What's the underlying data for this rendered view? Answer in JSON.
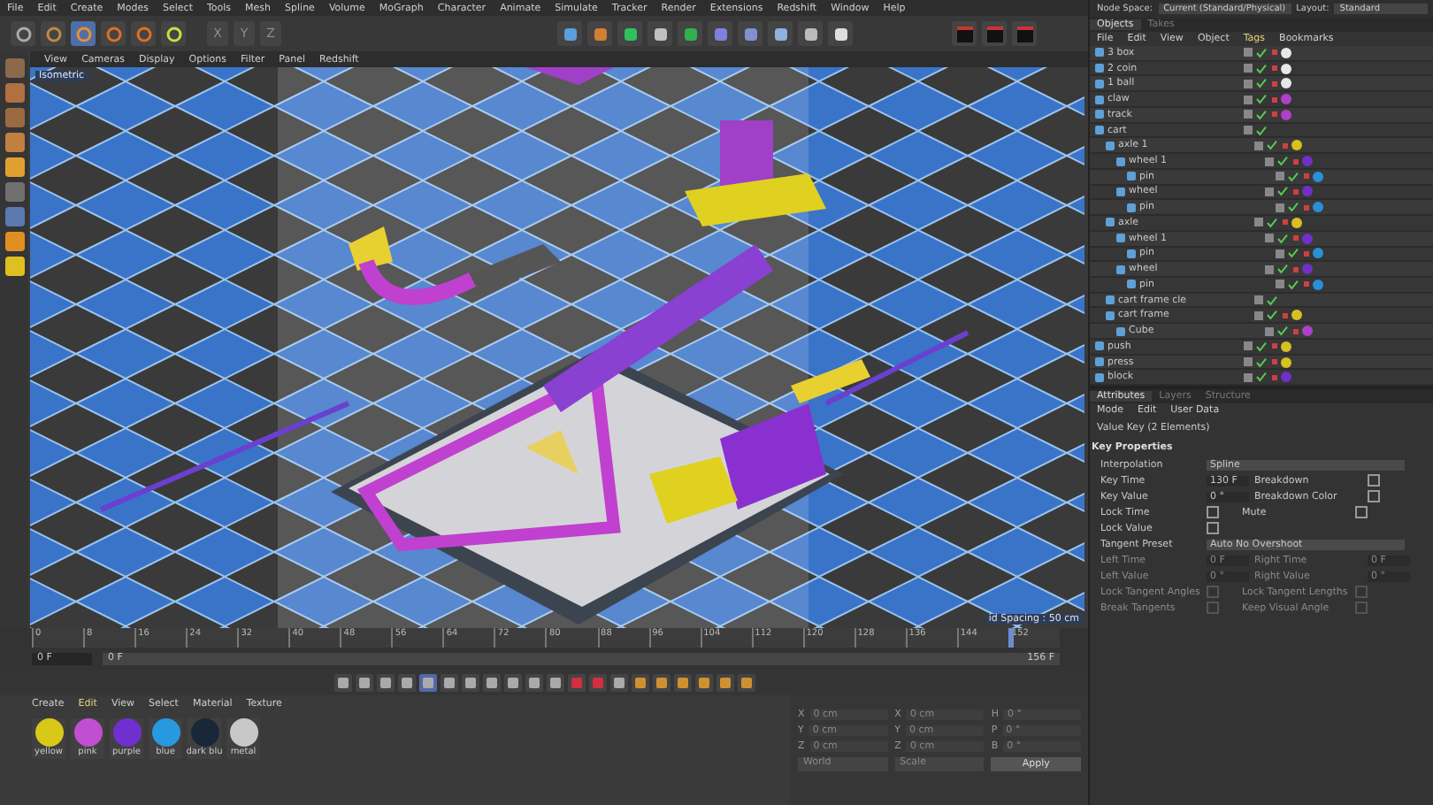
{
  "menu_bar": [
    "File",
    "Edit",
    "Create",
    "Modes",
    "Select",
    "Tools",
    "Mesh",
    "Spline",
    "Volume",
    "MoGraph",
    "Character",
    "Animate",
    "Simulate",
    "Tracker",
    "Render",
    "Extensions",
    "Redshift",
    "Window",
    "Help"
  ],
  "axis_locks": [
    "X",
    "Y",
    "Z"
  ],
  "node_space": {
    "label": "Node Space:",
    "value": "Current (Standard/Physical)",
    "layout_label": "Layout:",
    "layout_value": "Standard"
  },
  "viewport": {
    "menu": [
      "View",
      "Cameras",
      "Display",
      "Options",
      "Filter",
      "Panel",
      "Redshift"
    ],
    "camera": "Isometric",
    "grid_info": "id Spacing : 50 cm"
  },
  "objects": {
    "tabs": [
      {
        "label": "Objects",
        "selected": true
      },
      {
        "label": "Takes",
        "selected": false
      }
    ],
    "menu": [
      {
        "label": "File",
        "selected": false
      },
      {
        "label": "Edit",
        "selected": false
      },
      {
        "label": "View",
        "selected": false
      },
      {
        "label": "Object",
        "selected": false
      },
      {
        "label": "Tags",
        "selected": true
      },
      {
        "label": "Bookmarks",
        "selected": false
      }
    ],
    "tree": [
      {
        "name": "3 box",
        "color": "#e8e8e8"
      },
      {
        "name": "2 coin",
        "color": "#e8e8e8"
      },
      {
        "name": "1 ball",
        "color": "#e8e8e8"
      },
      {
        "name": "claw",
        "color": "#b040c8"
      },
      {
        "name": "track",
        "color": "#b040c8"
      },
      {
        "name": "cart",
        "children": [
          {
            "name": "axle 1",
            "color": "#d8c020",
            "children": [
              {
                "name": "wheel 1",
                "color": "#7030c8",
                "children": [
                  {
                    "name": "pin",
                    "color": "#2890d8"
                  }
                ]
              },
              {
                "name": "wheel",
                "color": "#7030c8",
                "children": [
                  {
                    "name": "pin",
                    "color": "#2890d8"
                  }
                ]
              }
            ]
          },
          {
            "name": "axle",
            "color": "#d8c020",
            "children": [
              {
                "name": "wheel 1",
                "color": "#7030c8",
                "children": [
                  {
                    "name": "pin",
                    "color": "#2890d8"
                  }
                ]
              },
              {
                "name": "wheel",
                "color": "#7030c8",
                "children": [
                  {
                    "name": "pin",
                    "color": "#2890d8"
                  }
                ]
              }
            ]
          },
          {
            "name": "cart frame cle"
          },
          {
            "name": "cart frame",
            "color": "#d8c020",
            "children": [
              {
                "name": "Cube",
                "color": "#b040c8"
              }
            ]
          }
        ]
      },
      {
        "name": "push",
        "color": "#d8c020"
      },
      {
        "name": "press",
        "color": "#d8c020"
      },
      {
        "name": "block",
        "color": "#7030c8"
      }
    ]
  },
  "attributes": {
    "tabs": [
      {
        "label": "Attributes",
        "selected": true
      },
      {
        "label": "Layers",
        "selected": false
      },
      {
        "label": "Structure",
        "selected": false
      }
    ],
    "menu": [
      "Mode",
      "Edit",
      "User Data"
    ],
    "title": "Value Key (2 Elements)",
    "section": "Key Properties",
    "fields": [
      {
        "kind": "dropdown",
        "label": "Interpolation",
        "value": "Spline",
        "disabled": false
      },
      {
        "kind": "pair",
        "label": "Key Time",
        "value": "130 F",
        "label2": "Breakdown",
        "checked2": false,
        "disabled": false
      },
      {
        "kind": "pair",
        "label": "Key Value",
        "value": "0 °",
        "label2": "Breakdown Color",
        "checked2": false,
        "disabled": false
      },
      {
        "kind": "checkpair",
        "label": "Lock Time",
        "checked": false,
        "label2": "Mute",
        "checked2": false,
        "disabled": false
      },
      {
        "kind": "check",
        "label": "Lock Value",
        "checked": false,
        "disabled": false
      },
      {
        "kind": "dropdown",
        "label": "Tangent Preset",
        "value": "Auto No Overshoot",
        "disabled": false
      },
      {
        "kind": "values",
        "label": "Left Time",
        "value": "0 F",
        "label2": "Right Time",
        "value2": "0 F",
        "disabled": true
      },
      {
        "kind": "values",
        "label": "Left Value",
        "value": "0 °",
        "label2": "Right Value",
        "value2": "0 °",
        "disabled": true
      },
      {
        "kind": "checkpair",
        "label": "Lock Tangent Angles",
        "checked": false,
        "label2": "Lock Tangent Lengths",
        "checked2": false,
        "disabled": true
      },
      {
        "kind": "checkpair",
        "label": "Break Tangents",
        "checked": false,
        "label2": "Keep Visual Angle",
        "checked2": false,
        "disabled": true
      }
    ]
  },
  "timeline": {
    "ticks": [
      "0",
      "8",
      "16",
      "24",
      "32",
      "40",
      "48",
      "56",
      "64",
      "72",
      "80",
      "88",
      "96",
      "104",
      "112",
      "120",
      "128",
      "136",
      "144",
      "152"
    ],
    "level": 0.95,
    "start": "0 F",
    "current": "0 F",
    "end": "156 F"
  },
  "materials": {
    "menu": [
      {
        "label": "Create",
        "selected": false
      },
      {
        "label": "Edit",
        "selected": true
      },
      {
        "label": "View",
        "selected": false
      },
      {
        "label": "Select",
        "selected": false
      },
      {
        "label": "Material",
        "selected": false
      },
      {
        "label": "Texture",
        "selected": false
      }
    ],
    "items": [
      {
        "name": "yellow",
        "color": "#d8c818"
      },
      {
        "name": "pink",
        "color": "#c050d0"
      },
      {
        "name": "purple",
        "color": "#7030d0"
      },
      {
        "name": "blue",
        "color": "#2898e0"
      },
      {
        "name": "dark blu",
        "color": "#182838"
      },
      {
        "name": "metal",
        "color": "#c8c8c8"
      }
    ]
  },
  "coordinates": {
    "rows": [
      [
        "X",
        "0 cm",
        "X",
        "0 cm",
        "H",
        "0 °"
      ],
      [
        "Y",
        "0 cm",
        "Y",
        "0 cm",
        "P",
        "0 °"
      ],
      [
        "Z",
        "0 cm",
        "Z",
        "0 cm",
        "B",
        "0 °"
      ]
    ],
    "mode": "World",
    "scale": "Scale",
    "apply": "Apply"
  }
}
